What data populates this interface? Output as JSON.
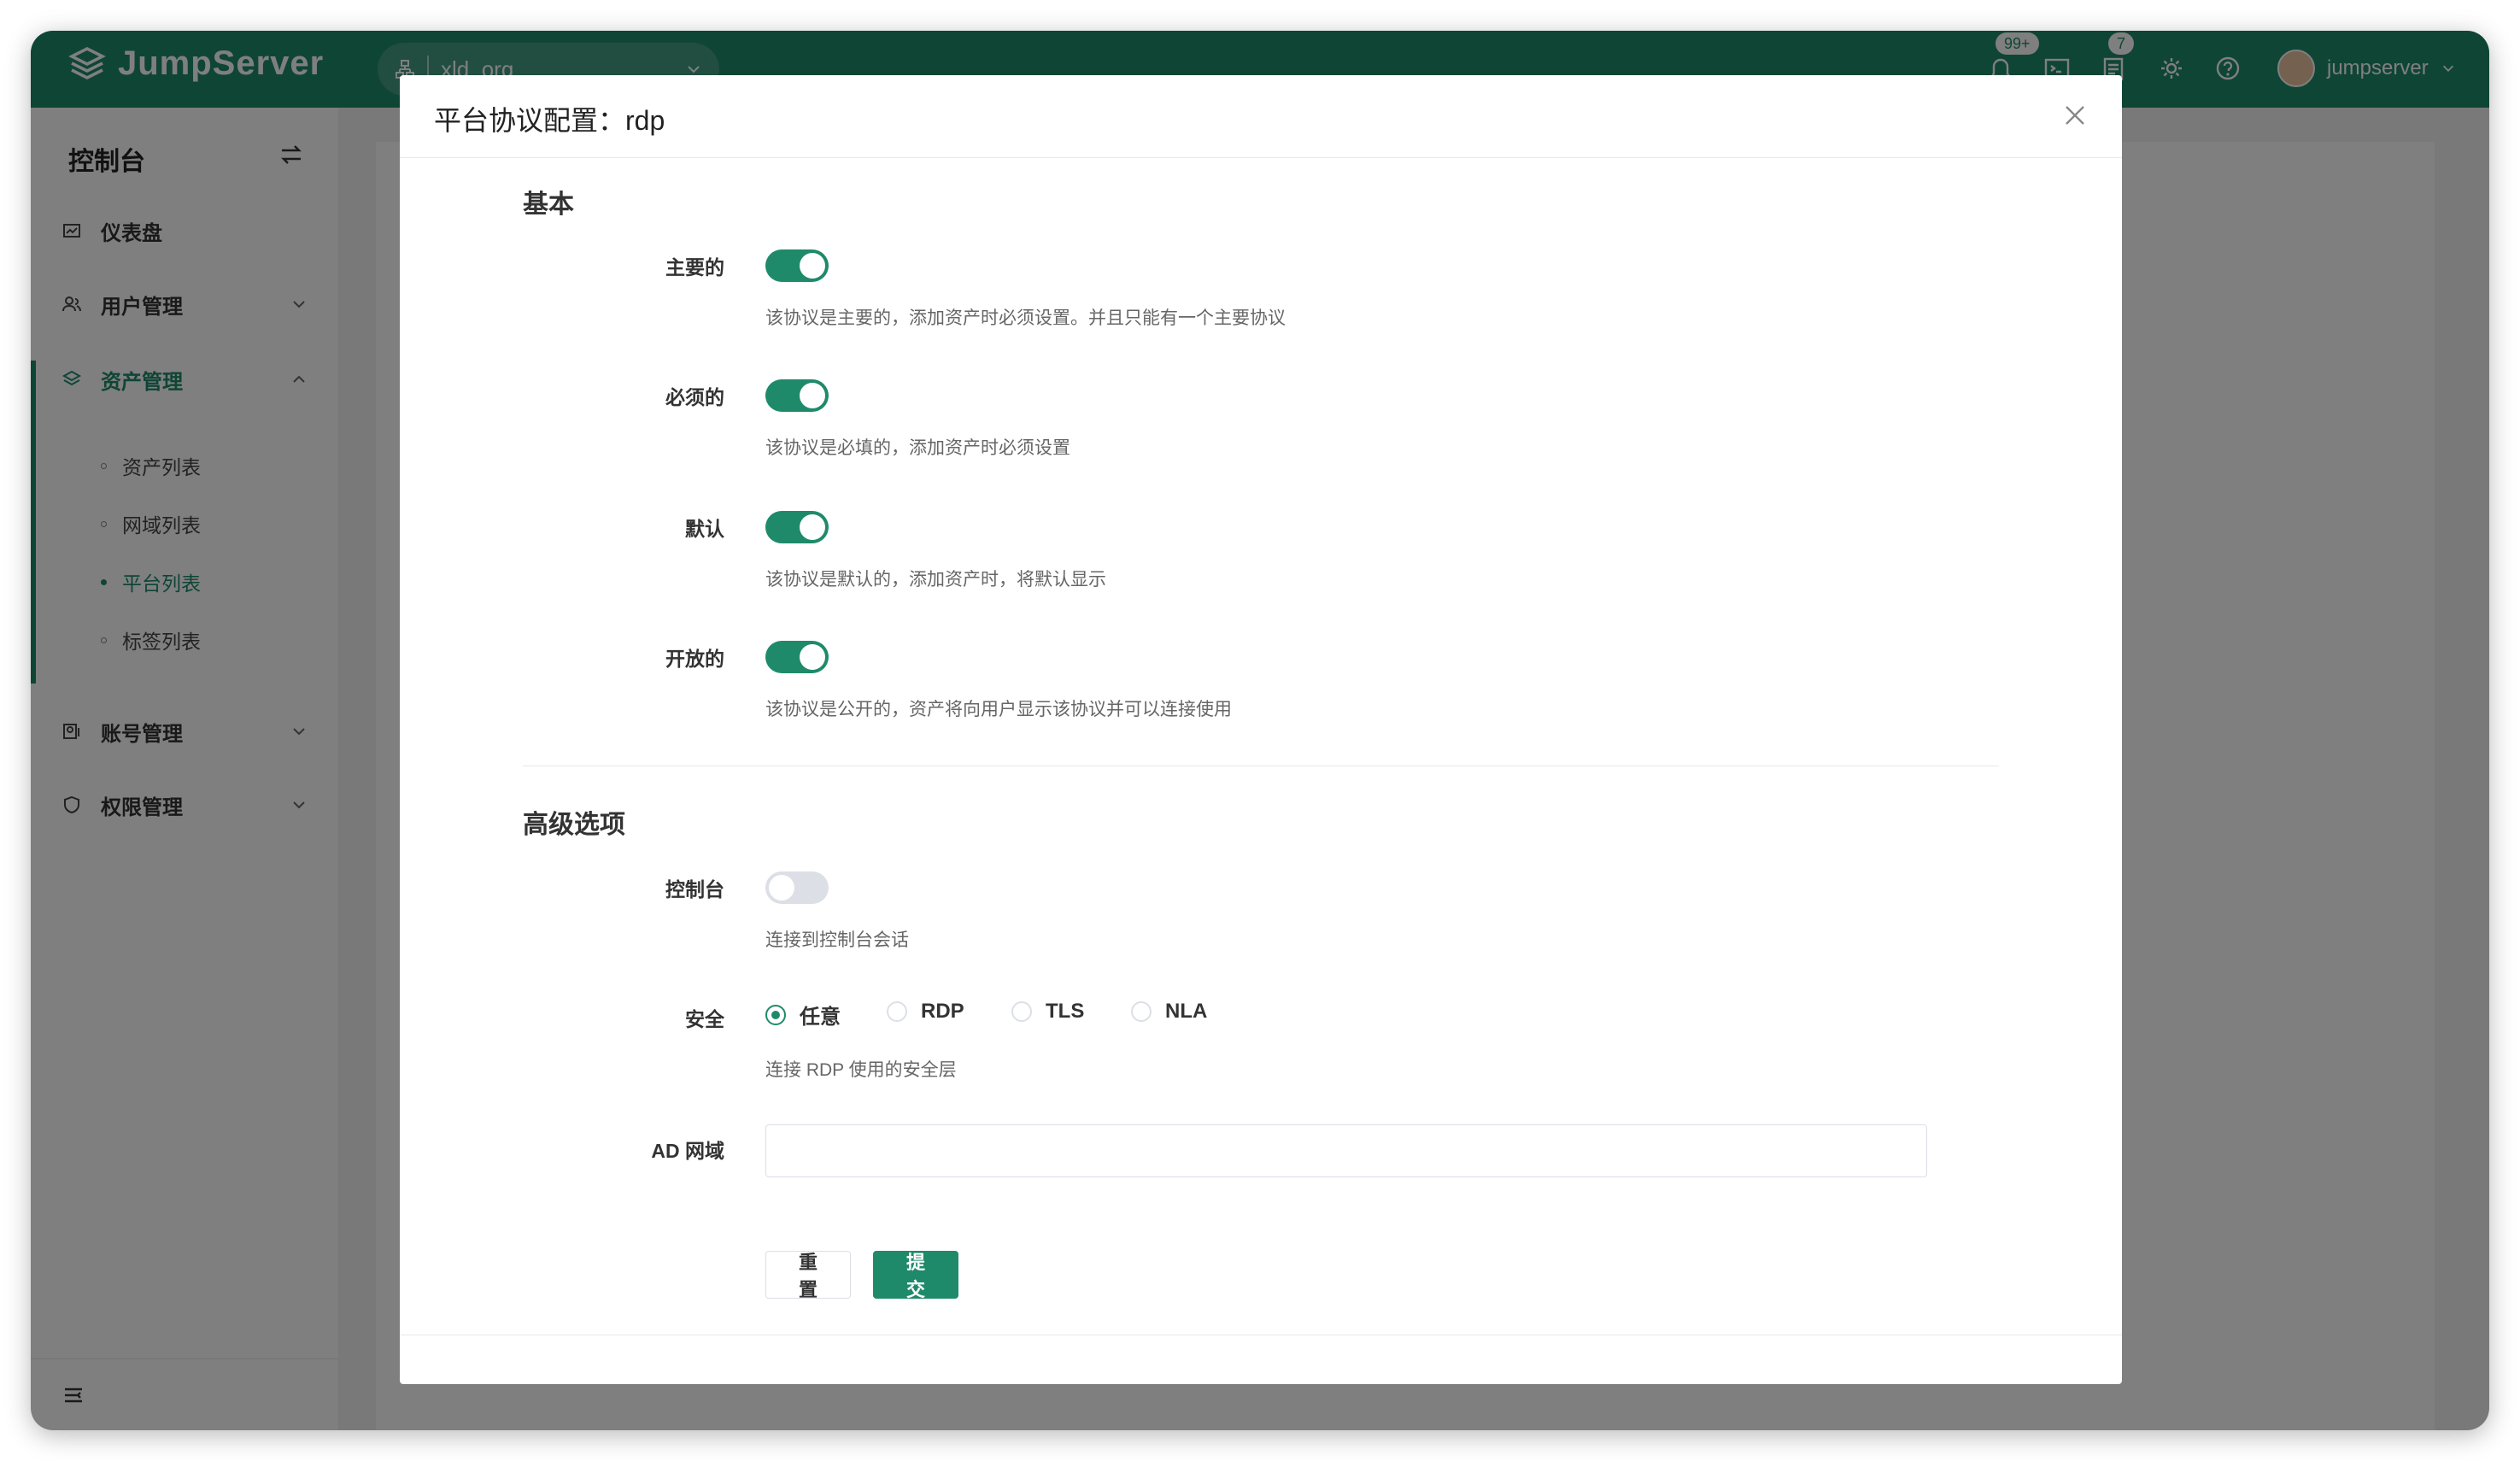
{
  "app": {
    "name": "JumpServer",
    "org": "xld_org"
  },
  "header": {
    "notif_badge": "99+",
    "tasks_badge": "7",
    "user": "jumpserver"
  },
  "sidebar": {
    "title": "控制台",
    "items": [
      {
        "label": "仪表盘"
      },
      {
        "label": "用户管理"
      },
      {
        "label": "资产管理"
      },
      {
        "label": "账号管理"
      },
      {
        "label": "权限管理"
      }
    ],
    "sub_items": [
      {
        "label": "资产列表"
      },
      {
        "label": "网域列表"
      },
      {
        "label": "平台列表"
      },
      {
        "label": "标签列表"
      }
    ]
  },
  "modal": {
    "title": "平台协议配置：rdp",
    "sections": {
      "basic": "基本",
      "advanced": "高级选项"
    },
    "basic": {
      "primary": {
        "label": "主要的",
        "on": true,
        "help": "该协议是主要的，添加资产时必须设置。并且只能有一个主要协议"
      },
      "required": {
        "label": "必须的",
        "on": true,
        "help": "该协议是必填的，添加资产时必须设置"
      },
      "default": {
        "label": "默认",
        "on": true,
        "help": "该协议是默认的，添加资产时，将默认显示"
      },
      "public": {
        "label": "开放的",
        "on": true,
        "help": "该协议是公开的，资产将向用户显示该协议并可以连接使用"
      }
    },
    "advanced": {
      "console": {
        "label": "控制台",
        "on": false,
        "help": "连接到控制台会话"
      },
      "security": {
        "label": "安全",
        "options": [
          "任意",
          "RDP",
          "TLS",
          "NLA"
        ],
        "selected": "任意",
        "help": "连接 RDP 使用的安全层"
      },
      "ad_domain": {
        "label": "AD 网域",
        "value": ""
      }
    },
    "buttons": {
      "reset": "重置",
      "submit": "提交"
    }
  },
  "colors": {
    "brand": "#1f8a6a"
  }
}
